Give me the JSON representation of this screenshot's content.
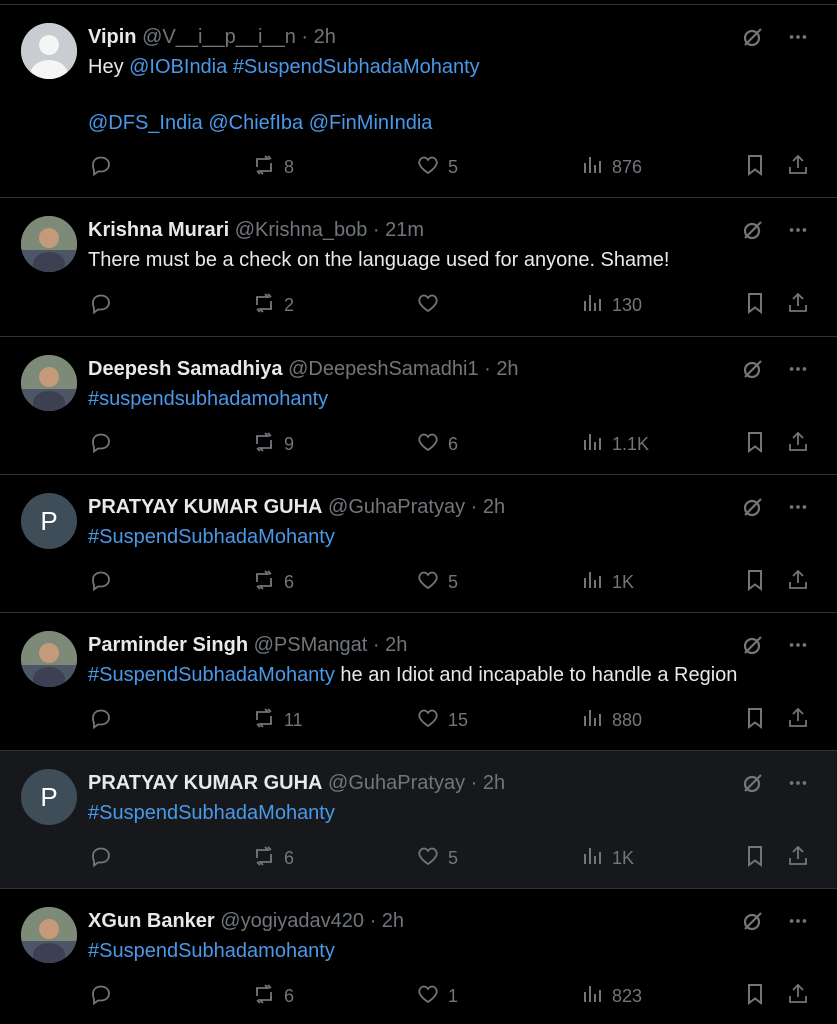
{
  "tweets": [
    {
      "name": "Vipin",
      "handle": "@V__i__p__i__n",
      "dot": "·",
      "time": "2h",
      "avatar": {
        "type": "gray",
        "letter": ""
      },
      "body_line1": [
        {
          "t": "Hey ",
          "link": false
        },
        {
          "t": "@IOBIndia",
          "link": true
        },
        {
          "t": " ",
          "link": false
        },
        {
          "t": "#SuspendSubhadaMohanty",
          "link": true
        }
      ],
      "body_line2": [
        {
          "t": "@DFS_India",
          "link": true
        },
        {
          "t": " ",
          "link": false
        },
        {
          "t": "@ChiefIba",
          "link": true
        },
        {
          "t": " ",
          "link": false
        },
        {
          "t": "@FinMinIndia",
          "link": true
        }
      ],
      "retweets": "8",
      "likes": "5",
      "views": "876"
    },
    {
      "name": "Krishna Murari",
      "handle": "@Krishna_bob",
      "dot": "·",
      "time": "21m",
      "avatar": {
        "type": "photo",
        "letter": ""
      },
      "body_line1": [
        {
          "t": "There must be a check on the language used for anyone. Shame!",
          "link": false
        }
      ],
      "retweets": "2",
      "likes": "",
      "views": "130"
    },
    {
      "name": "Deepesh Samadhiya",
      "handle": "@DeepeshSamadhi1",
      "dot": "·",
      "time": "2h",
      "avatar": {
        "type": "photo",
        "letter": ""
      },
      "body_line1": [
        {
          "t": "#suspendsubhadamohanty",
          "link": true
        }
      ],
      "retweets": "9",
      "likes": "6",
      "views": "1.1K"
    },
    {
      "name": "PRATYAY KUMAR GUHA",
      "handle": "@GuhaPratyay",
      "dot": "·",
      "time": "2h",
      "avatar": {
        "type": "letter",
        "letter": "P"
      },
      "body_line1": [
        {
          "t": "#SuspendSubhadaMohanty",
          "link": true
        }
      ],
      "retweets": "6",
      "likes": "5",
      "views": "1K"
    },
    {
      "name": "Parminder Singh",
      "handle": "@PSMangat",
      "dot": "·",
      "time": "2h",
      "avatar": {
        "type": "photo",
        "letter": ""
      },
      "body_line1": [
        {
          "t": "#SuspendSubhadaMohanty",
          "link": true
        },
        {
          "t": " he an Idiot and incapable to handle a Region",
          "link": false
        }
      ],
      "retweets": "11",
      "likes": "15",
      "views": "880"
    },
    {
      "name": "PRATYAY KUMAR GUHA",
      "handle": "@GuhaPratyay",
      "dot": "·",
      "time": "2h",
      "avatar": {
        "type": "letter",
        "letter": "P"
      },
      "body_line1": [
        {
          "t": "#SuspendSubhadaMohanty",
          "link": true
        }
      ],
      "retweets": "6",
      "likes": "5",
      "views": "1K"
    },
    {
      "name": "XGun Banker",
      "handle": "@yogiyadav420",
      "dot": "·",
      "time": "2h",
      "avatar": {
        "type": "photo",
        "letter": ""
      },
      "body_line1": [
        {
          "t": "#SuspendSubhadamohanty",
          "link": true
        }
      ],
      "retweets": "6",
      "likes": "1",
      "views": "823"
    }
  ],
  "icons": {
    "reply": "reply-icon",
    "retweet": "retweet-icon",
    "like": "heart-icon",
    "views": "views-icon",
    "bookmark": "bookmark-icon",
    "share": "share-icon",
    "grok": "grok-icon",
    "more": "more-icon"
  },
  "colors": {
    "link": "#4a99e9",
    "muted": "#71767b",
    "text": "#e7e9ea",
    "border": "#2f3336",
    "highlight": "#16181c"
  }
}
